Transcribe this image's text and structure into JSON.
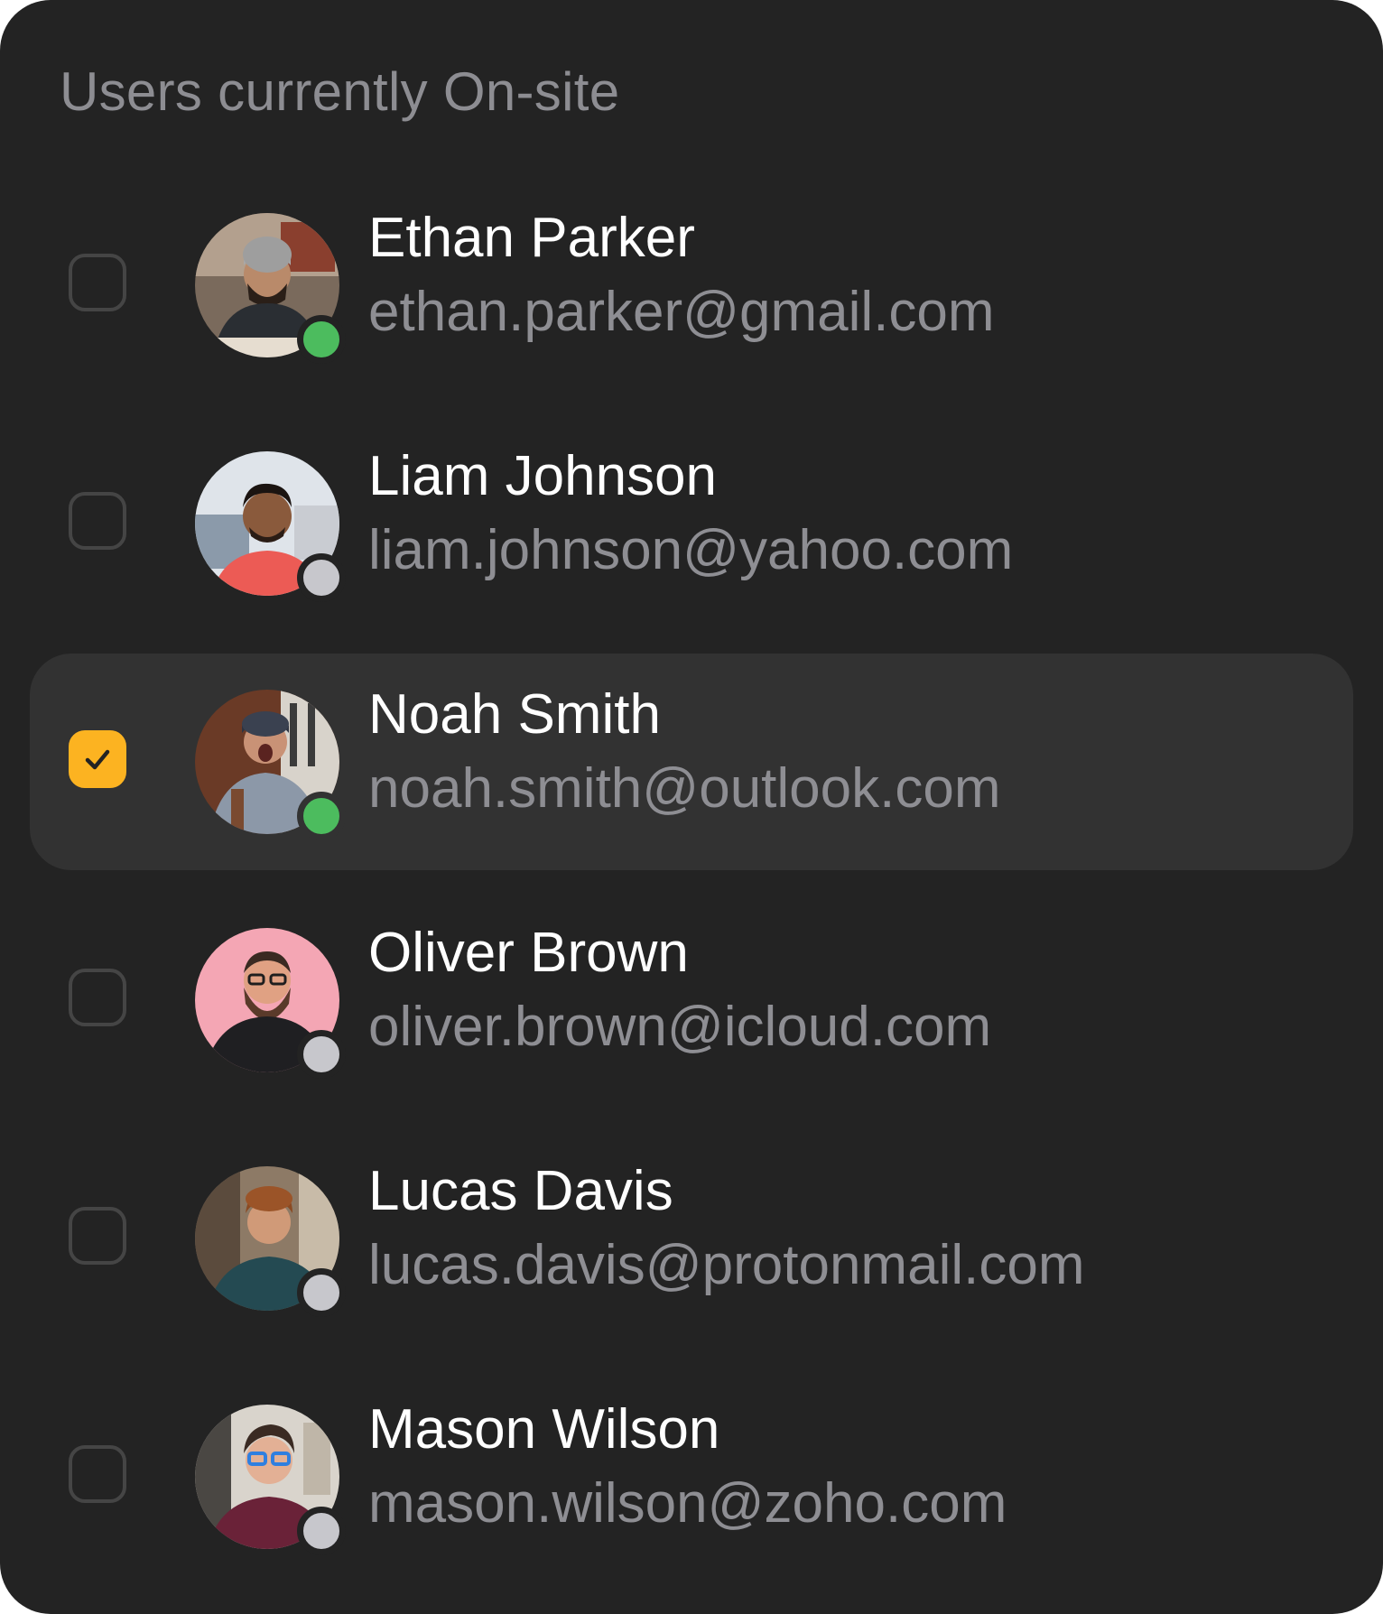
{
  "panel": {
    "title": "Users currently On-site"
  },
  "colors": {
    "online": "#4cbc5e",
    "offline": "#c7c7cc",
    "checkbox_checked": "#fcb321",
    "background": "#232323",
    "selected_row": "#323232"
  },
  "users": [
    {
      "name": "Ethan Parker",
      "email": "ethan.parker@gmail.com",
      "status": "online",
      "selected": false,
      "avatar_icon": "avatar-ethan-parker-photo"
    },
    {
      "name": "Liam Johnson",
      "email": "liam.johnson@yahoo.com",
      "status": "offline",
      "selected": false,
      "avatar_icon": "avatar-liam-johnson-photo"
    },
    {
      "name": "Noah Smith",
      "email": "noah.smith@outlook.com",
      "status": "online",
      "selected": true,
      "avatar_icon": "avatar-noah-smith-photo"
    },
    {
      "name": "Oliver Brown",
      "email": "oliver.brown@icloud.com",
      "status": "offline",
      "selected": false,
      "avatar_icon": "avatar-oliver-brown-photo"
    },
    {
      "name": "Lucas Davis",
      "email": "lucas.davis@protonmail.com",
      "status": "offline",
      "selected": false,
      "avatar_icon": "avatar-lucas-davis-photo"
    },
    {
      "name": "Mason Wilson",
      "email": "mason.wilson@zoho.com",
      "status": "offline",
      "selected": false,
      "avatar_icon": "avatar-mason-wilson-photo"
    }
  ]
}
